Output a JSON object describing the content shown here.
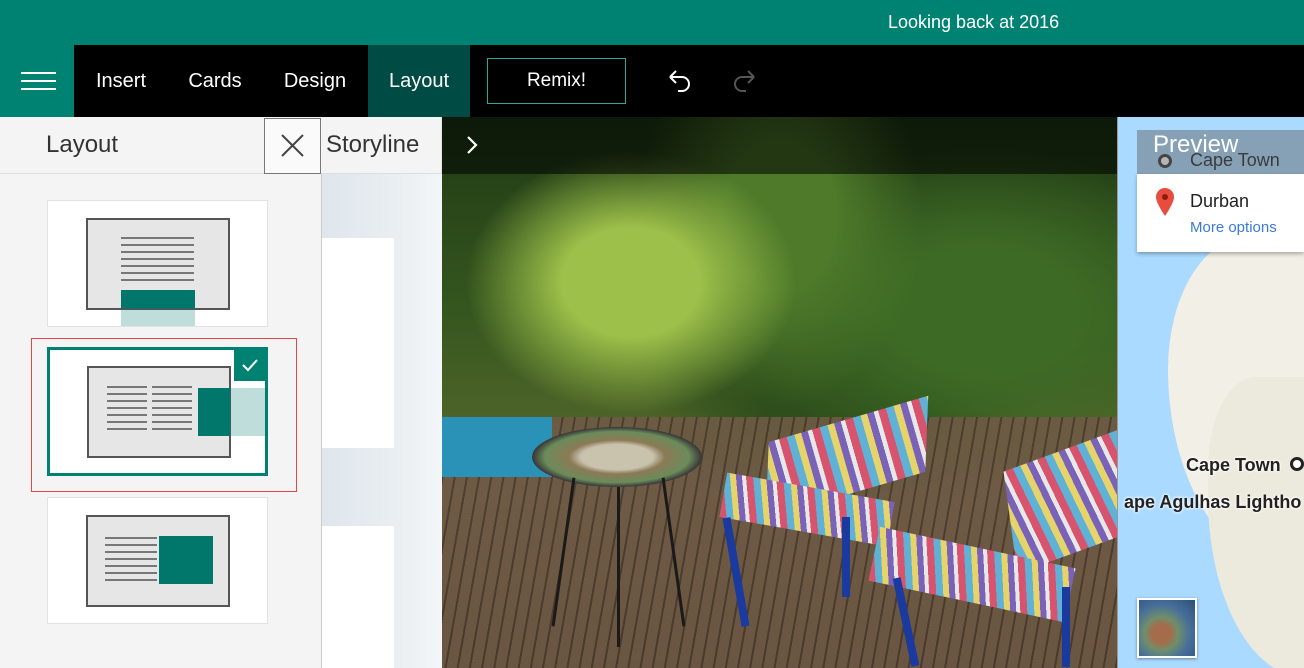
{
  "title_bar": {
    "title": "Looking back at 2016"
  },
  "toolbar": {
    "menu_icon": "hamburger-icon",
    "tabs": [
      {
        "label": "Insert"
      },
      {
        "label": "Cards"
      },
      {
        "label": "Design"
      },
      {
        "label": "Layout",
        "active": true
      }
    ],
    "remix_label": "Remix!",
    "undo_icon": "undo-icon",
    "redo_icon": "redo-icon"
  },
  "layout_panel": {
    "title": "Layout",
    "close_icon": "close-icon",
    "options": [
      {
        "name": "text-top-image-bottom"
      },
      {
        "name": "two-columns-image-right",
        "selected": true
      },
      {
        "name": "text-left-image-right"
      }
    ]
  },
  "storyline": {
    "label": "Storyline",
    "next_icon": "chevron-right-icon"
  },
  "preview": {
    "label": "Preview",
    "directions": {
      "from": "Cape Town",
      "to": "Durban",
      "more_options": "More options"
    },
    "map_labels": [
      "Cape Town",
      "ape Agulhas Lightho"
    ]
  },
  "colors": {
    "brand": "#008272",
    "toolbar_bg": "#000000",
    "active_tab": "#004b43",
    "selection_outline": "#e34848"
  }
}
